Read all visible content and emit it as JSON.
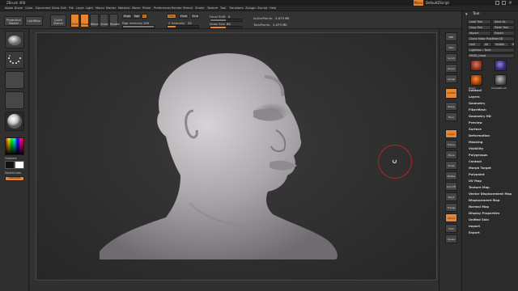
{
  "window": {
    "title": "ZBrush 4R8",
    "menu_top_right": "Menu",
    "default_script": "DefaultZScript",
    "colors": {
      "accent": "#e88530",
      "panel": "#303030",
      "background": "#2a2a2a"
    }
  },
  "menubar": [
    "Alpha",
    "Brush",
    "Color",
    "Document",
    "Draw",
    "Edit",
    "File",
    "Layer",
    "Light",
    "Macro",
    "Marker",
    "Material",
    "Movie",
    "Picker",
    "Preferences",
    "Render",
    "Stencil",
    "Stroke",
    "Texture",
    "Tool",
    "Transform",
    "Zplugin",
    "Zscript",
    "Help"
  ],
  "topshelf": {
    "projection_master": "Projection Master",
    "lightbox": "LightBox",
    "quick_sketch": "Quick Sketch",
    "edit": "Edit",
    "draw": "Draw",
    "move": "Move",
    "scale": "Scale",
    "rotate": "Rotate",
    "mrgb": "Mrgb",
    "rgb": "Rgb",
    "m": "M",
    "zadd": "Zadd",
    "zsub": "Zsub",
    "zcut": "Zcut",
    "rgb_intensity_label": "Rgb Intensity",
    "rgb_intensity_value": "100",
    "z_intensity_label": "Z Intensity",
    "z_intensity_value": "25",
    "z_intensity_fraction": 0.25,
    "focal_shift_label": "Focal Shift",
    "focal_shift_value": "0",
    "draw_size_label": "Draw Size",
    "draw_size_value": "64",
    "draw_size_fraction": 0.5,
    "active_points_label": "ActivePoints:",
    "active_points_value": "2.073 Mil",
    "total_points_label": "TotalPoints:",
    "total_points_value": "2.073 Mil"
  },
  "leftshelf": {
    "gradient_label": "Gradient",
    "switch_color_label": "SwitchColor",
    "alternate_label": "Alternate"
  },
  "rightshelf": {
    "buttons": [
      "BPR",
      "SPix",
      "Scroll",
      "Zoom",
      "Actual",
      "AAHalf",
      "Persp",
      "Floor",
      "L.Sym",
      "Frame",
      "Move",
      "Scale",
      "Rotate",
      "Line Fill",
      "PolyF",
      "Transp",
      "Ghost",
      "Solo",
      "Xpose"
    ]
  },
  "tray": {
    "title": "Tool",
    "load_tool": "Load Tool",
    "save_as": "Save As",
    "copy_tool": "Copy Tool",
    "paste_tool": "Paste Tool",
    "import": "Import",
    "export": "Export",
    "clone": "Clone",
    "make_polymesh": "Make PolyMesh3D",
    "goz": "GoZ",
    "all": "All",
    "visible": "Visible",
    "r": "R",
    "lightbox_tools": "Lightbox › Tools",
    "current_tool": "PM3D_Head",
    "thumbs": [
      "Head",
      "SimpleBrush",
      "PolySphere",
      "Cylinder3D"
    ],
    "sections": [
      "Subtool",
      "Layers",
      "Geometry",
      "FiberMesh",
      "Geometry HD",
      "Preview",
      "Surface",
      "Deformation",
      "Masking",
      "Visibility",
      "Polygroups",
      "Contact",
      "Morph Target",
      "Polypaint",
      "UV Map",
      "Texture Map",
      "Vector Displacement Map",
      "Displacement Map",
      "Normal Map",
      "Display Properties",
      "Unified Skin",
      "Import",
      "Export"
    ]
  }
}
